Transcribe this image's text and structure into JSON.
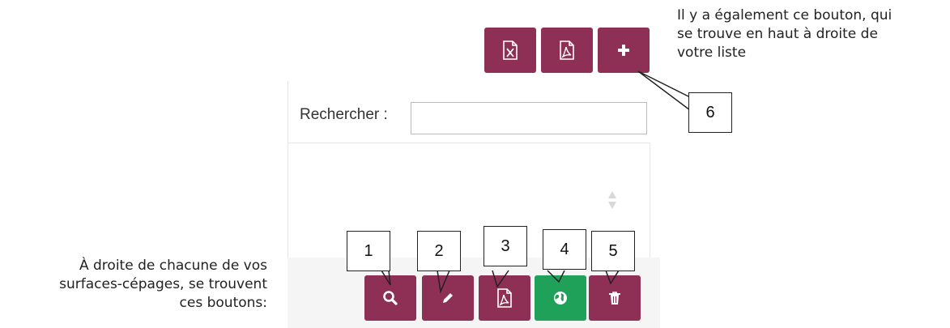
{
  "note_top_right": {
    "line1": "Il y a également ce bouton, qui",
    "line2": "se trouve en haut à droite de",
    "line3": "votre liste"
  },
  "note_bottom_left": {
    "line1": "À droite de chacune de vos",
    "line2": "surfaces-cépages, se trouvent",
    "line3": "ces boutons:"
  },
  "search": {
    "label": "Rechercher :",
    "value": ""
  },
  "callouts": {
    "c1": "1",
    "c2": "2",
    "c3": "3",
    "c4": "4",
    "c5": "5",
    "c6": "6"
  },
  "colors": {
    "button": "#8e2f55",
    "map_button": "#1fa15a"
  },
  "icons": {
    "top_toolbar": [
      "excel-file-icon",
      "pdf-file-icon",
      "plus-icon"
    ],
    "row_actions": [
      "magnifier-icon",
      "pencil-icon",
      "pdf-file-icon",
      "globe-icon",
      "trash-icon"
    ]
  }
}
